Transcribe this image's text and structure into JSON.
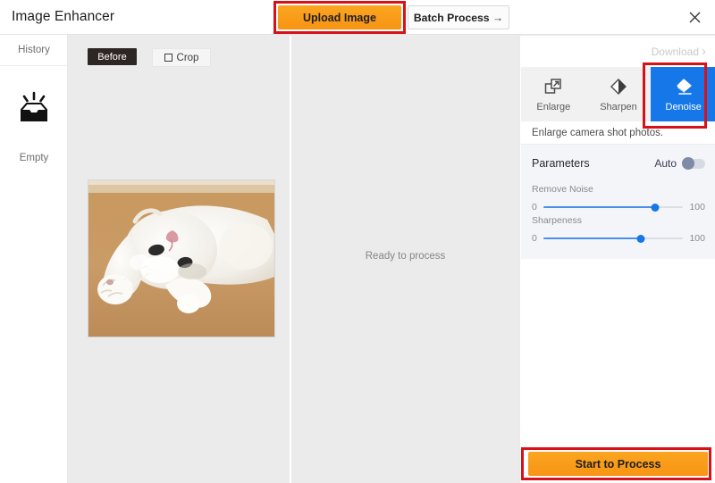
{
  "header": {
    "app_title": "Image Enhancer",
    "upload_label": "Upload Image",
    "batch_label": "Batch Process →",
    "close_icon": "close-icon"
  },
  "sidebar": {
    "history_label": "History",
    "empty_label": "Empty",
    "empty_icon": "empty-inbox-icon"
  },
  "left_panel": {
    "before_label": "Before",
    "crop_label": "Crop",
    "crop_icon": "crop-icon",
    "image_alt": "white fluffy cat lying on tan floor"
  },
  "center_panel": {
    "status_text": "Ready to process"
  },
  "right_panel": {
    "download_label": "Download",
    "download_chevron": "›",
    "modes": [
      {
        "label": "Enlarge",
        "icon": "enlarge-icon",
        "active": false
      },
      {
        "label": "Sharpen",
        "icon": "sharpen-icon",
        "active": false
      },
      {
        "label": "Denoise",
        "icon": "denoise-eraser-icon",
        "active": true
      }
    ],
    "mode_description": "Enlarge camera shot photos.",
    "parameters": {
      "title": "Parameters",
      "auto_label": "Auto",
      "auto_enabled": false,
      "sliders": [
        {
          "label": "Remove Noise",
          "min": "0",
          "max": "100",
          "percent": 80
        },
        {
          "label": "Sharpeness",
          "min": "0",
          "max": "100",
          "percent": 70
        }
      ]
    },
    "process_label": "Start to Process"
  },
  "colors": {
    "accent_orange": "#f79414",
    "active_blue": "#1677e8",
    "slider_blue": "#4a90e8",
    "highlight_red": "#d81118",
    "panel_gray": "#ebebeb",
    "card_gray": "#f4f5f8"
  }
}
